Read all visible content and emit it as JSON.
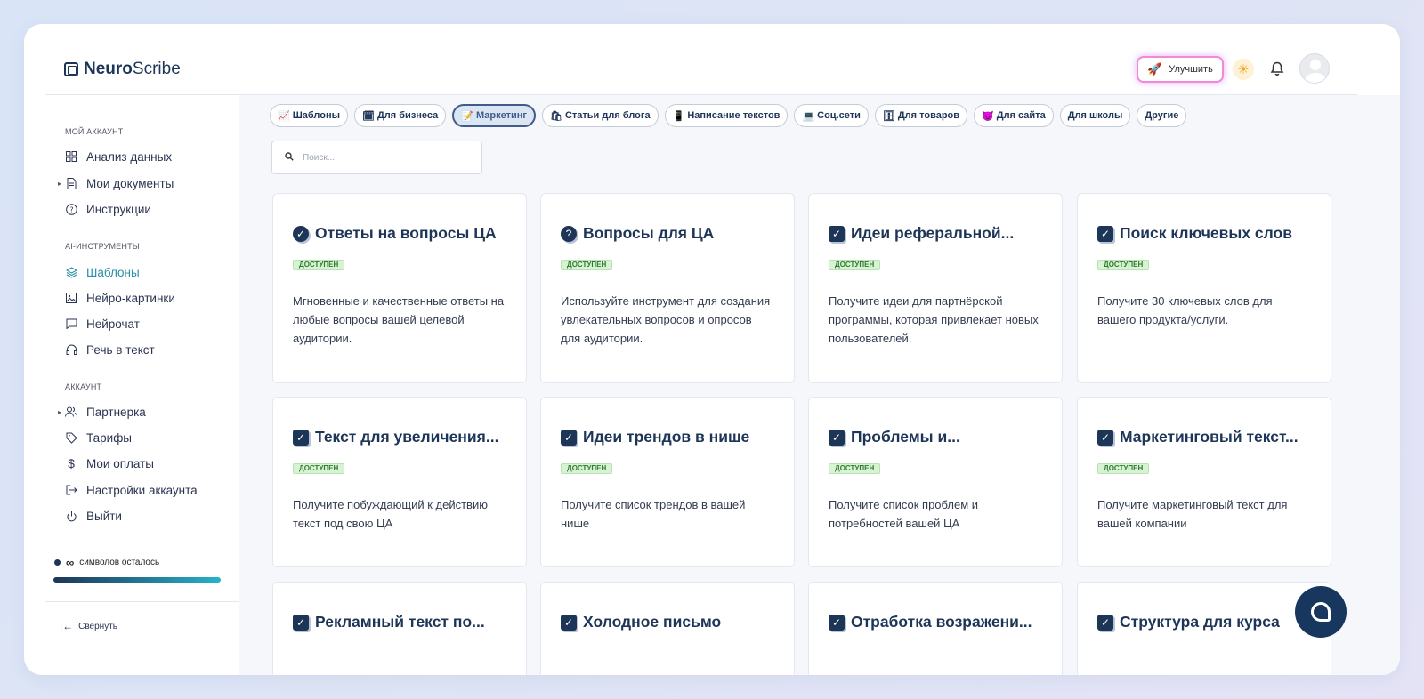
{
  "app": {
    "logo_bold": "Neuro",
    "logo_rest": "Scribe"
  },
  "topbar": {
    "upgrade_label": "Улучшить",
    "icons": [
      "rocket-icon",
      "sun-icon",
      "bell-icon",
      "avatar"
    ]
  },
  "sidebar": {
    "sections": [
      {
        "title": "МОЙ АККАУНТ"
      },
      {
        "title": "AI-ИНСТРУМЕНТЫ"
      },
      {
        "title": "АККАУНТ"
      }
    ],
    "items": [
      {
        "label": "Анализ данных",
        "icon": "grid-icon"
      },
      {
        "label": "Мои документы",
        "icon": "document-icon"
      },
      {
        "label": "Инструкции",
        "icon": "help-circle-icon"
      },
      {
        "label": "Шаблоны",
        "icon": "layers-icon"
      },
      {
        "label": "Нейро-картинки",
        "icon": "image-icon"
      },
      {
        "label": "Нейрочат",
        "icon": "chat-icon"
      },
      {
        "label": "Речь в текст",
        "icon": "headphones-icon"
      },
      {
        "label": "Партнерка",
        "icon": "users-icon"
      },
      {
        "label": "Тарифы",
        "icon": "tag-icon"
      },
      {
        "label": "Мои оплаты",
        "icon": "dollar-icon"
      },
      {
        "label": "Настройки аккаунта",
        "icon": "login-icon"
      },
      {
        "label": "Выйти",
        "icon": "power-icon"
      }
    ],
    "symbols_value": "∞",
    "symbols_label": "символов осталось",
    "symbols_progress": 1.0,
    "collapse_label": "Свернуть"
  },
  "filters": [
    {
      "label": "Шаблоны",
      "emoji": "📈"
    },
    {
      "label": "Для бизнеса",
      "emoji": "🗓"
    },
    {
      "label": "Маркетинг",
      "emoji": "📝"
    },
    {
      "label": "Статьи для блога",
      "emoji": "🛍"
    },
    {
      "label": "Написание текстов",
      "emoji": "📱"
    },
    {
      "label": "Соц.сети",
      "emoji": "💻"
    },
    {
      "label": "Для товаров",
      "emoji": "🗄"
    },
    {
      "label": "Для сайта",
      "emoji": "😈"
    },
    {
      "label": "Для школы",
      "emoji": ""
    },
    {
      "label": "Другие",
      "emoji": ""
    }
  ],
  "active_filter": "Маркетинг",
  "search": {
    "placeholder": "Поиск..."
  },
  "status_label": "ДОСТУПЕН",
  "cards": [
    {
      "title": "Ответы на вопросы ЦА",
      "desc": "Мгновенные и качественные ответы на любые вопросы вашей целевой аудитории.",
      "icon": "check-circle-icon"
    },
    {
      "title": "Вопросы для ЦА",
      "desc": "Используйте инструмент для создания увлекательных вопросов и опросов для аудитории.",
      "icon": "question-circle-icon"
    },
    {
      "title": "Идеи реферальной...",
      "desc": "Получите идеи для партнёрской программы, которая привлекает новых пользователей.",
      "icon": "checkbox-icon"
    },
    {
      "title": "Поиск ключевых слов",
      "desc": "Получите 30 ключевых слов для вашего продукта/услуги.",
      "icon": "checkbox-icon"
    },
    {
      "title": "Текст для увеличения...",
      "desc": "Получите побуждающий к действию текст под свою ЦА",
      "icon": "checkbox-icon"
    },
    {
      "title": "Идеи трендов в нише",
      "desc": "Получите список трендов в вашей нише",
      "icon": "checkbox-icon"
    },
    {
      "title": "Проблемы и...",
      "desc": "Получите список проблем и потребностей вашей ЦА",
      "icon": "checkbox-icon"
    },
    {
      "title": "Маркетинговый текст...",
      "desc": "Получите маркетинговый текст для вашей компании",
      "icon": "checkbox-icon"
    },
    {
      "title": "Рекламный текст по...",
      "desc": "",
      "icon": "checkbox-icon"
    },
    {
      "title": "Холодное письмо",
      "desc": "",
      "icon": "checkbox-icon"
    },
    {
      "title": "Отработка возражени...",
      "desc": "",
      "icon": "checkbox-icon"
    },
    {
      "title": "Структура для курса",
      "desc": "",
      "icon": "checkbox-icon"
    }
  ]
}
